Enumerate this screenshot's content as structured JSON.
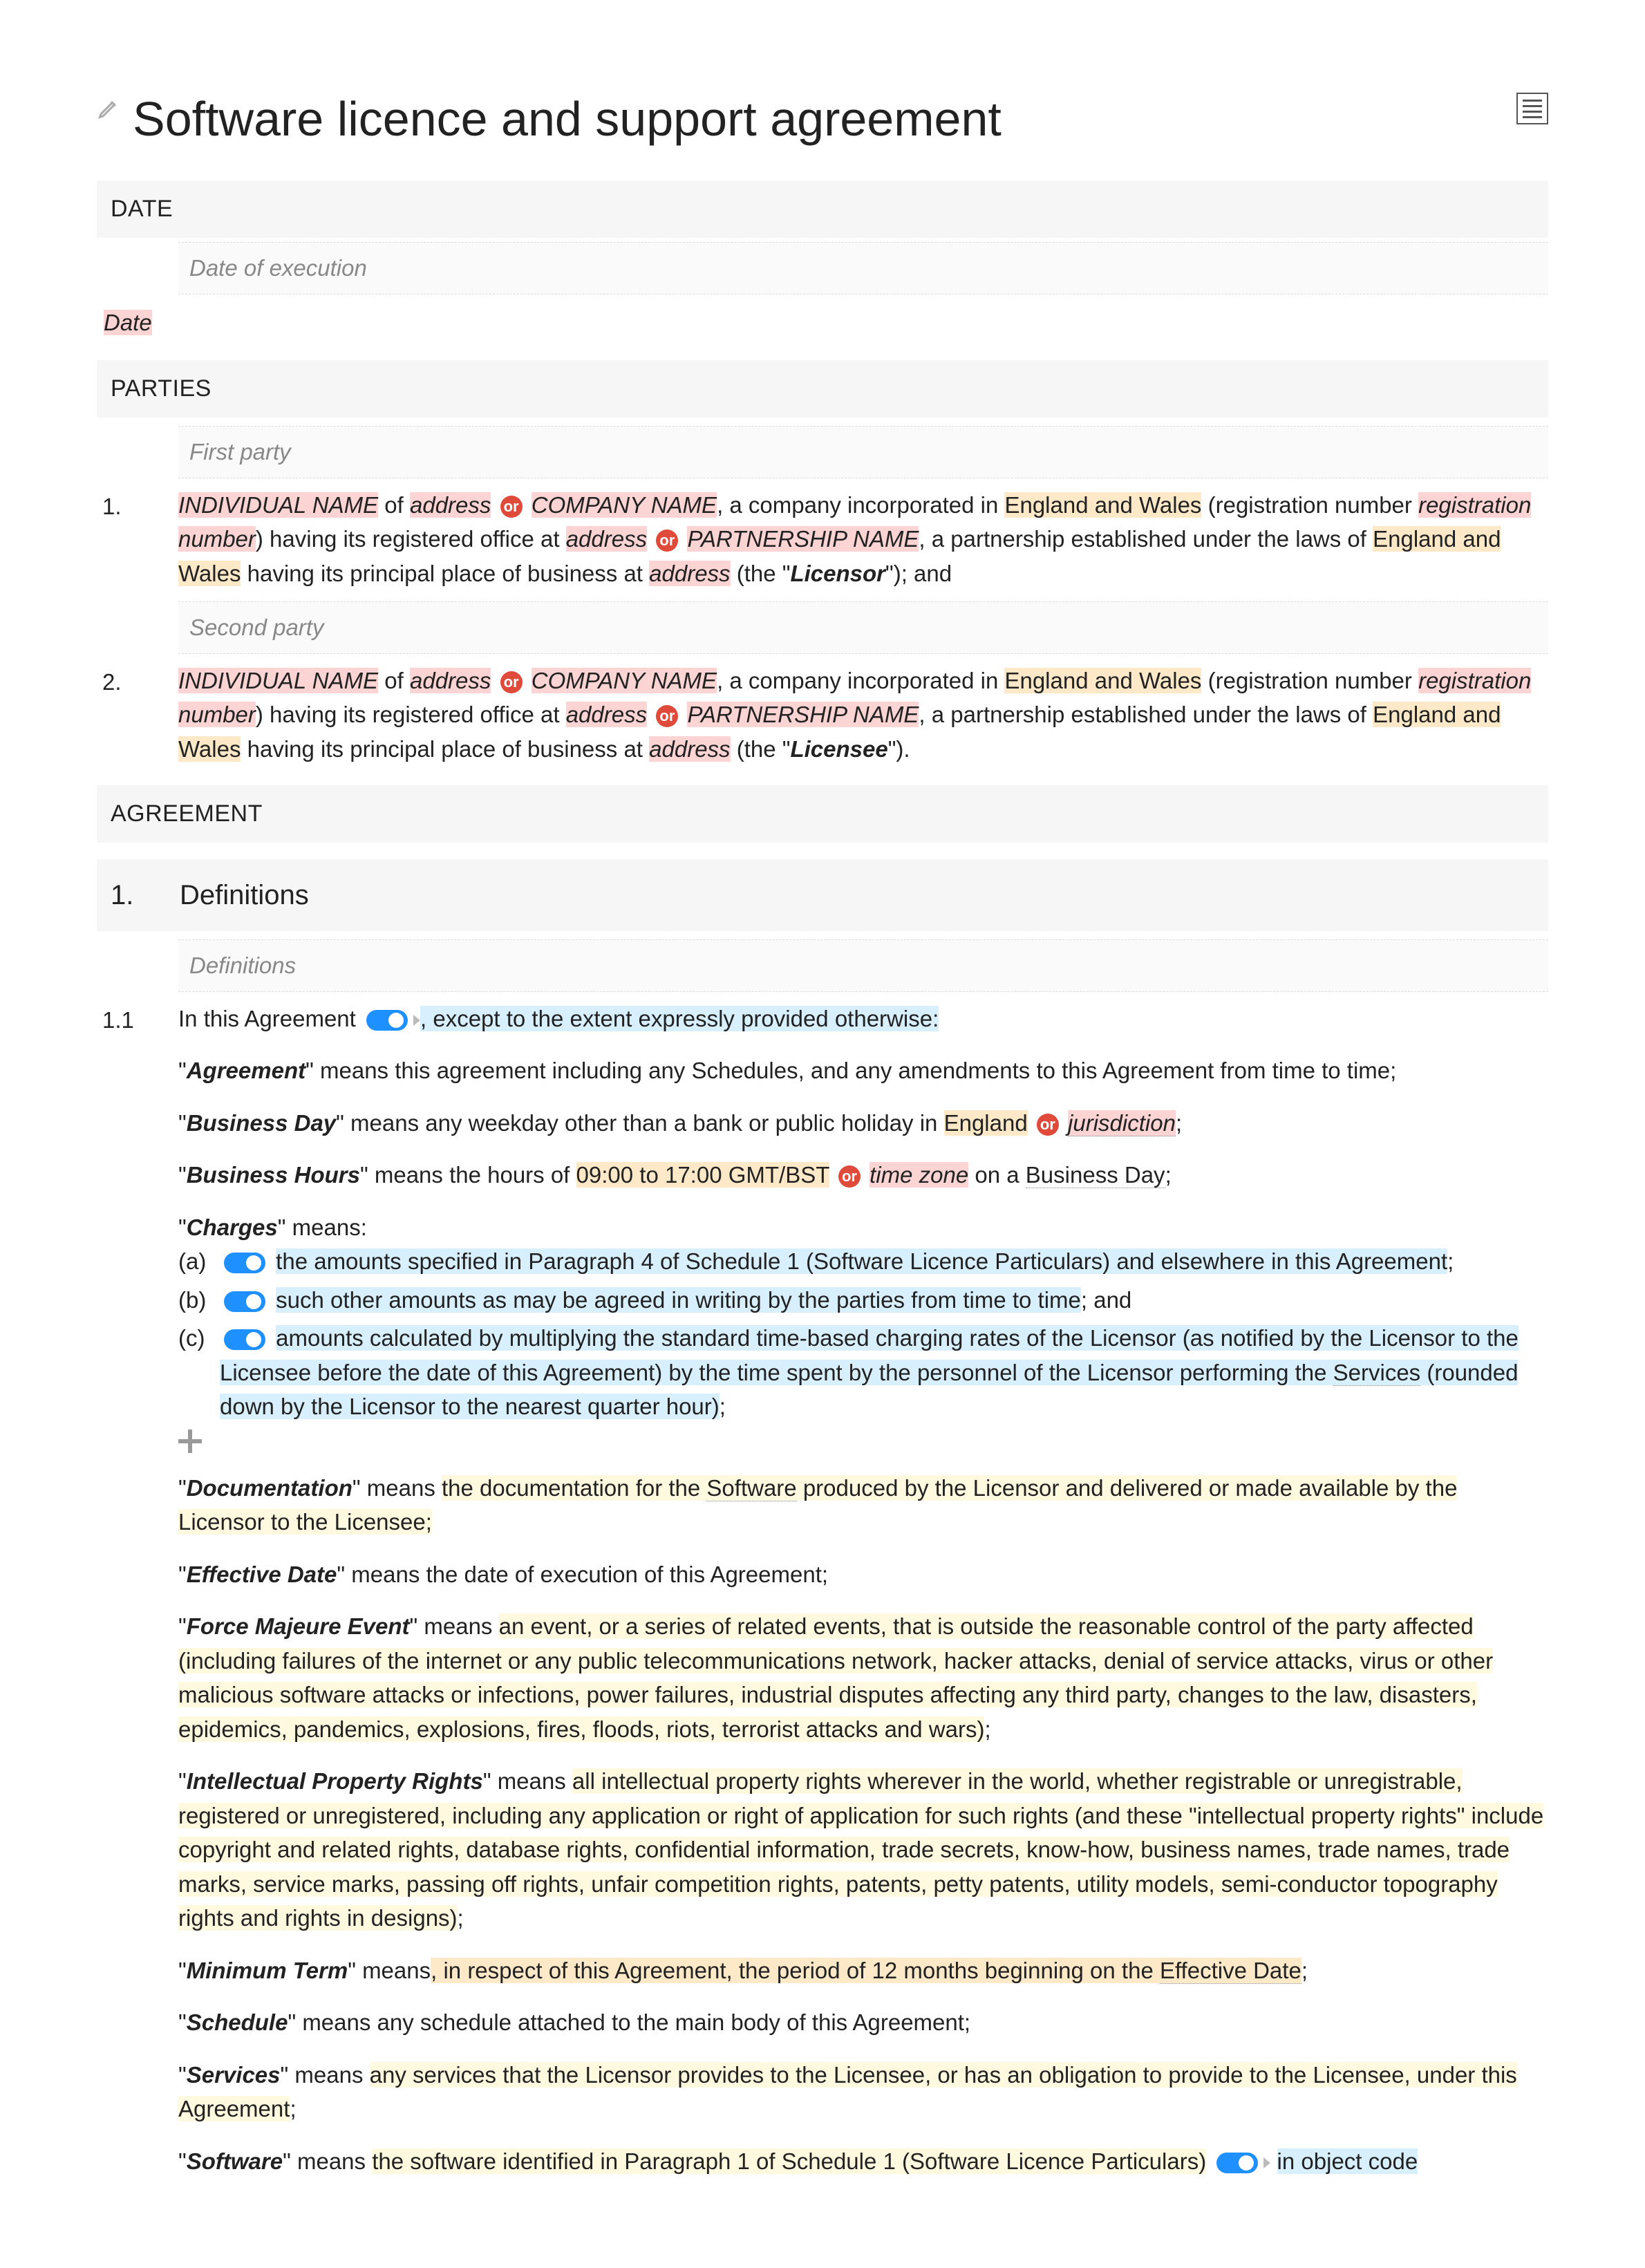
{
  "title": "Software licence and support agreement",
  "sections": {
    "date": {
      "head": "DATE",
      "sublabel": "Date of execution",
      "value": "Date"
    },
    "parties": {
      "head": "PARTIES",
      "first_label": "First party",
      "second_label": "Second party",
      "row1_num": "1.",
      "row2_num": "2.",
      "p1": {
        "name": "INDIVIDUAL NAME",
        "of": " of ",
        "addr": "address",
        "or": "or",
        "company": "COMPANY NAME",
        "inc_text": ", a company incorporated in ",
        "jur": "England and Wales",
        "regnum_open": " (registration number ",
        "regnum": "registration number",
        "regoffice": ") having its registered office at ",
        "addr2": "address",
        "partnership": "PARTNERSHIP NAME",
        "part_text": ", a partnership established under the laws of ",
        "jur2": "England and Wales",
        "principal": " having its principal place of business at ",
        "addr3": "address",
        "role_open": " (the \"",
        "role": "Licensor",
        "role_close": "\"); and"
      },
      "p2": {
        "name": "INDIVIDUAL NAME",
        "of": " of ",
        "addr": "address",
        "or": "or",
        "company": "COMPANY NAME",
        "inc_text": ", a company incorporated in ",
        "jur": "England and Wales",
        "regnum_open": " (registration number ",
        "regnum": "registration number",
        "regoffice": ") having its registered office at ",
        "addr2": "address",
        "partnership": "PARTNERSHIP NAME",
        "part_text": ", a partnership established under the laws of ",
        "jur2": "England and Wales",
        "principal": " having its principal place of business at ",
        "addr3": "address",
        "role_open": " (the \"",
        "role": "Licensee",
        "role_close": "\")."
      }
    },
    "agreement_head": "AGREEMENT",
    "defs_head": {
      "num": "1.",
      "title": "Definitions"
    },
    "defs_sublabel": "Definitions",
    "clause_1_1_num": "1.1",
    "c11_intro_a": "In this Agreement",
    "c11_intro_b": ", except to the extent expressly provided otherwise:",
    "defs": {
      "agreement": {
        "term": "Agreement",
        "body": "\" means this agreement including any Schedules, and any amendments to this Agreement from time to time;"
      },
      "business_day": {
        "term": "Business Day",
        "a": "\" means any weekday other than a bank or public holiday in ",
        "eng": "England",
        "or": "or",
        "jur": "jurisdiction",
        "end": ";"
      },
      "business_hours": {
        "term": "Business Hours",
        "a": "\" means the hours of ",
        "hrs": "09:00 to 17:00 GMT/BST",
        "or": "or",
        "tz": "time zone",
        "b": " on a ",
        "bd": "Business Day",
        "end": ";"
      },
      "charges": {
        "term": "Charges",
        "intro": "\" means:",
        "a_label": "(a)",
        "a_text": "the amounts specified in Paragraph 4 of Schedule 1 (Software Licence Particulars) and elsewhere in this Agreement",
        "a_end": ";",
        "b_label": "(b)",
        "b_text": "such other amounts as may be agreed in writing by the parties from time to time",
        "b_end": "; and",
        "c_label": "(c)",
        "c_text1": "amounts calculated by multiplying the standard time-based charging rates of the Licensor (as notified by ",
        "c_text2": "the Licensor to the Licensee before the date of this Agreement) by the time spent by the personnel of the Licensor performing the ",
        "c_svc": "Services",
        "c_text3": " (rounded down by the Licensor to the nearest quarter hour)",
        "c_end": ";"
      },
      "documentation": {
        "term": "Documentation",
        "a": "\" means ",
        "b": "the documentation for the ",
        "sw": "Software",
        "c": " produced by the Licensor and delivered or made available by the Licensor to the Licensee;"
      },
      "effective_date": {
        "term": "Effective Date",
        "body": "\" means the date of execution of this Agreement;"
      },
      "fme": {
        "term": "Force Majeure Event",
        "a": "\" means ",
        "b": "an event, or a series of related events, that is outside the reasonable control of the party affected (including failures of the internet or any public telecommunications network, hacker attacks, denial of service attacks, virus or other malicious software attacks or infections, power failures, industrial disputes affecting any third party, changes to the law, disasters, epidemics, pandemics, explosions, fires, floods, riots, terrorist attacks and wars)",
        "end": ";"
      },
      "ipr": {
        "term": "Intellectual Property Rights",
        "a": "\" means ",
        "b": "all intellectual property rights wherever in the world, whether registrable or unregistrable, registered or unregistered, including any application or right of application for such rights (and these \"intellectual property rights\" include copyright and related rights, database rights, confidential information, trade secrets, know-how, business names, trade names, trade marks, service marks, passing off rights, unfair competition rights, patents, petty patents, utility models, semi-conductor topography rights and rights in designs)",
        "end": ";"
      },
      "min_term": {
        "term": "Minimum Term",
        "a": "\" means",
        "b": ", in respect of this Agreement, the period of 12 months beginning on the ",
        "ed": "Effective Date",
        "end": ";"
      },
      "schedule": {
        "term": "Schedule",
        "body": "\" means any schedule attached to the main body of this Agreement;"
      },
      "services": {
        "term": "Services",
        "a": "\" means ",
        "b": "any services that the Licensor provides to the Licensee, or has an obligation to provide to the Licensee, under this Agreement",
        "end": ";"
      },
      "software": {
        "term": "Software",
        "a": "\" means ",
        "b": "the software identified in Paragraph 1 of Schedule 1 (Software Licence Particulars)",
        "c": "in object code"
      }
    }
  }
}
